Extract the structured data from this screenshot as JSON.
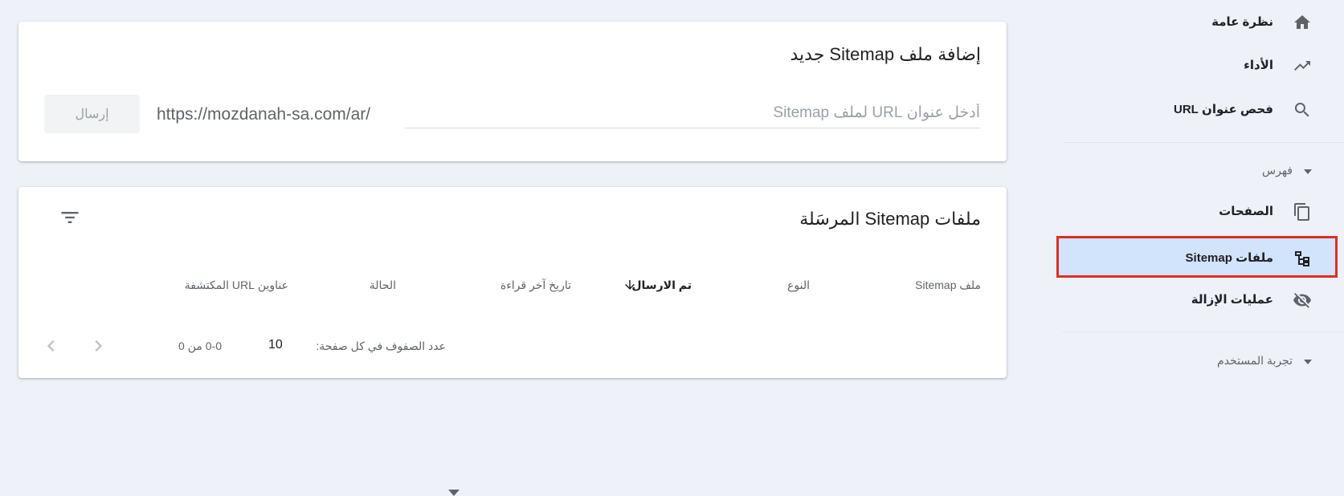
{
  "add_sitemap": {
    "title": "إضافة ملف Sitemap جديد",
    "url_prefix": "https://mozdanah-sa.com/ar/",
    "input_placeholder": "أدخل عنوان URL لملف Sitemap",
    "input_value": "",
    "submit_label": "إرسال"
  },
  "submitted": {
    "title": "ملفات Sitemap المرسَلة",
    "columns": [
      "ملف Sitemap",
      "النوع",
      "تم الارسال",
      "تاريخ آخر قراءة",
      "الحالة",
      "عناوين URL المكتشفة"
    ],
    "sorted_column": "تم الارسال",
    "pagination": {
      "rows_per_page_label": "عدد الصفوف في كل صفحة:",
      "rows_per_page": "10",
      "range": "0-0 من 0"
    }
  },
  "sidebar": {
    "items": [
      {
        "label": "نظرة عامة",
        "icon": "home-icon"
      },
      {
        "label": "الأداء",
        "icon": "trending-up-icon"
      },
      {
        "label": "فحص عنوان URL",
        "icon": "search-icon"
      }
    ],
    "index_section": "فهرس",
    "index_items": [
      {
        "label": "الصفحات",
        "icon": "pages-icon"
      },
      {
        "label": "ملفات Sitemap",
        "icon": "sitemap-icon",
        "active": true
      },
      {
        "label": "عمليات الإزالة",
        "icon": "removal-eye-icon"
      }
    ],
    "ux_section": "تجربة المستخدم"
  },
  "colors": {
    "background": "#eef1f8",
    "active_nav_bg": "#d2e3fc",
    "highlight_border": "#d93025"
  }
}
